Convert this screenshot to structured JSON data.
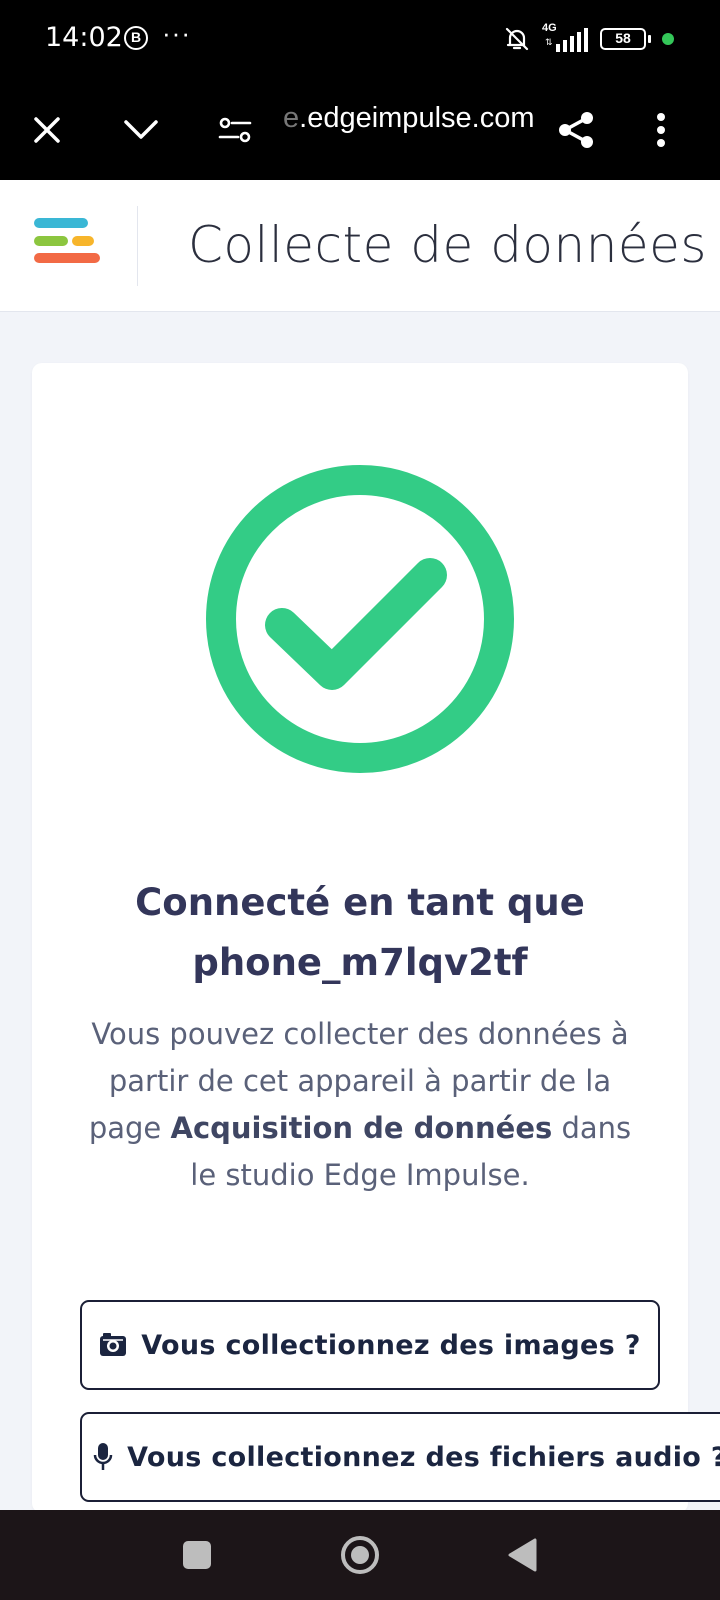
{
  "status_bar": {
    "time": "14:02",
    "b_badge": "B",
    "dots": "···",
    "network": "4G",
    "battery": "58"
  },
  "browser": {
    "url_faded": "e",
    "url_main": ".edgeimpulse.com"
  },
  "header": {
    "title": "Collecte de données"
  },
  "main": {
    "connected_line1": "Connecté en tant que",
    "connected_line2": "phone_m7lqv2tf",
    "desc_part1": "Vous pouvez collecter des données à partir de cet appareil à partir de la page ",
    "desc_bold": "Acquisition de données",
    "desc_part2": " dans le studio Edge Impulse.",
    "images_button": "Vous collectionnez des images ?",
    "audio_button": "Vous collectionnez des fichiers audio ?"
  },
  "colors": {
    "success": "#33cc86",
    "logo_blue": "#3ab7d5",
    "logo_green": "#8cc63f",
    "logo_yellow": "#f7b52b",
    "logo_red": "#f26a45"
  }
}
